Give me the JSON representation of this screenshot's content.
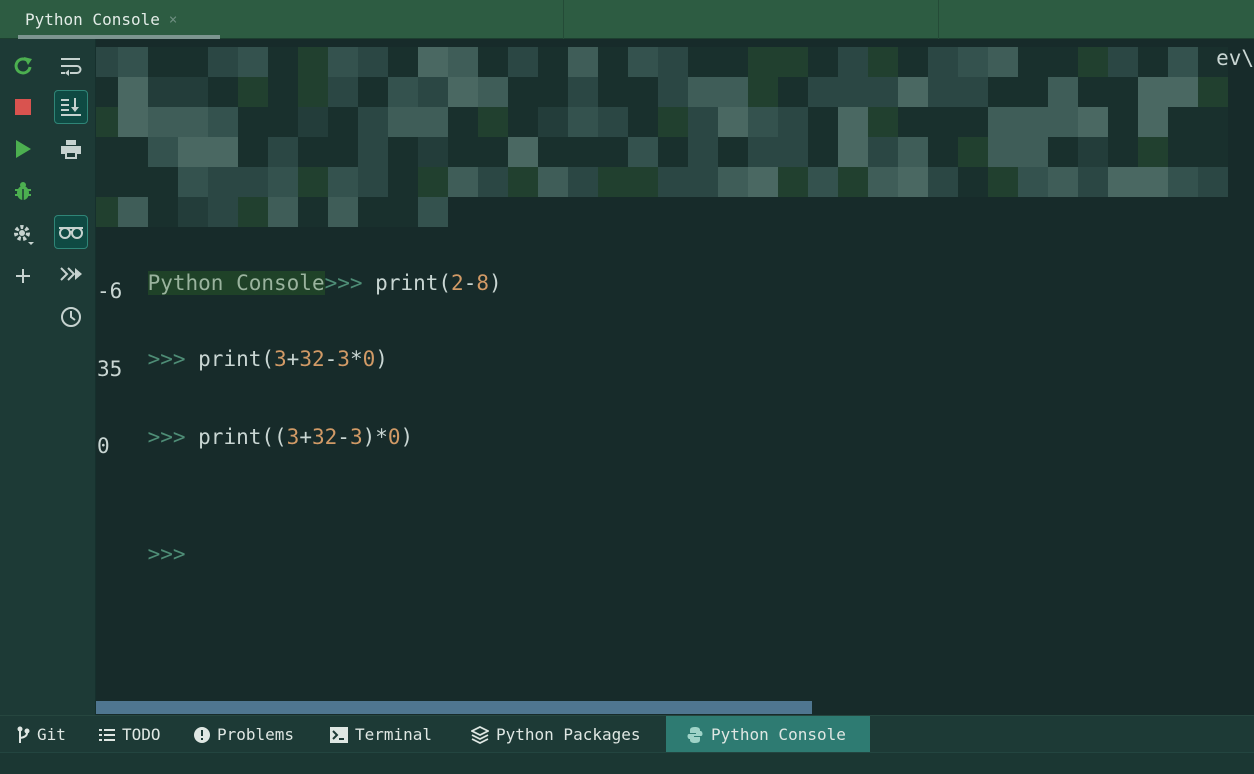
{
  "tab": {
    "title": "Python Console",
    "close": "×"
  },
  "toolbar": {
    "left_column": [
      {
        "icon": "rerun-icon"
      },
      {
        "icon": "stop-icon"
      },
      {
        "icon": "run-icon"
      },
      {
        "icon": "debug-icon"
      },
      {
        "icon": "settings-icon"
      },
      {
        "icon": "add-icon"
      }
    ],
    "right_column": [
      {
        "icon": "soft-wrap-icon",
        "active": false
      },
      {
        "icon": "scroll-to-end-icon",
        "active": true
      },
      {
        "icon": "print-icon",
        "active": false
      },
      {
        "icon": "show-variables-icon",
        "active": true
      },
      {
        "icon": "execute-selection-icon",
        "active": false
      },
      {
        "icon": "history-icon",
        "active": false
      }
    ]
  },
  "console": {
    "clipped_tail": "ev\\",
    "console_label": "Python Console",
    "lines": [
      {
        "prompt": ">>> ",
        "code": [
          "print(",
          "2",
          "-",
          "8",
          ")"
        ]
      },
      {
        "output": "-6"
      },
      {
        "prompt": ">>> ",
        "code": [
          "print(",
          "3",
          "+",
          "32",
          "-",
          "3",
          "*",
          "0",
          ")"
        ]
      },
      {
        "output": "35"
      },
      {
        "prompt": ">>> ",
        "code": [
          "print((",
          "3",
          "+",
          "32",
          "-",
          "3",
          ")*",
          "0",
          ")"
        ]
      },
      {
        "output": "0"
      },
      {
        "prompt": ">>>"
      }
    ]
  },
  "bottom_tabs": [
    {
      "label": "Git",
      "icon": "git-branch-icon",
      "active": false
    },
    {
      "label": "TODO",
      "icon": "list-icon",
      "active": false
    },
    {
      "label": "Problems",
      "icon": "problems-icon",
      "active": false
    },
    {
      "label": "Terminal",
      "icon": "terminal-icon",
      "active": false
    },
    {
      "label": "Python Packages",
      "icon": "packages-icon",
      "active": false
    },
    {
      "label": "Python Console",
      "icon": "python-icon",
      "active": true
    }
  ],
  "colors": {
    "background": "#172b2a",
    "tab_bar": "#2d5c42",
    "prompt": "#4e8d76",
    "number": "#d19a66",
    "active_tab": "#2e7b72",
    "scrollbar": "#4f7690"
  }
}
